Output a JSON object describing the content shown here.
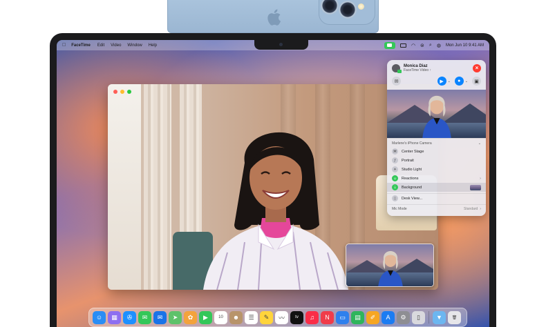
{
  "menubar": {
    "app_name": "FaceTime",
    "menus": [
      "Edit",
      "Video",
      "Window",
      "Help"
    ],
    "clock": "Mon Jun 10  9:41 AM"
  },
  "panel": {
    "caller_name": "Monica Diaz",
    "caller_status": "FaceTime Video ↑",
    "camera_section": "Marlene's iPhone Camera",
    "items": [
      {
        "label": "Center Stage",
        "icon": "center-stage-icon"
      },
      {
        "label": "Portrait",
        "icon": "portrait-icon"
      },
      {
        "label": "Studio Light",
        "icon": "studio-light-icon"
      },
      {
        "label": "Reactions",
        "icon": "reactions-icon"
      },
      {
        "label": "Background",
        "icon": "background-icon"
      }
    ],
    "desk_view": "Desk View...",
    "mic_mode_label": "Mic Mode",
    "mic_mode_value": "Standard"
  },
  "colors": {
    "facetime_green": "#34c759",
    "accent_blue": "#0a84ff",
    "end_red": "#ff3b30"
  },
  "dock_apps": [
    {
      "name": "finder",
      "color": "#2a8df4",
      "glyph": "☺"
    },
    {
      "name": "launchpad",
      "color": "#8e6ff0",
      "glyph": "▦"
    },
    {
      "name": "safari",
      "color": "#1e90ff",
      "glyph": "✇"
    },
    {
      "name": "messages",
      "color": "#34c759",
      "glyph": "✉"
    },
    {
      "name": "mail",
      "color": "#1a73e8",
      "glyph": "✉"
    },
    {
      "name": "maps",
      "color": "#5ec26a",
      "glyph": "➤"
    },
    {
      "name": "photos",
      "color": "#f3a33c",
      "glyph": "✿"
    },
    {
      "name": "facetime",
      "color": "#34c759",
      "glyph": "▶"
    },
    {
      "name": "calendar",
      "color": "#ffffff",
      "glyph": "10"
    },
    {
      "name": "contacts",
      "color": "#b8946a",
      "glyph": "☻"
    },
    {
      "name": "reminders",
      "color": "#ffffff",
      "glyph": "☰"
    },
    {
      "name": "notes",
      "color": "#ffd43b",
      "glyph": "✎"
    },
    {
      "name": "freeform",
      "color": "#ffffff",
      "glyph": "〰"
    },
    {
      "name": "tv",
      "color": "#111111",
      "glyph": "tv"
    },
    {
      "name": "music",
      "color": "#fa2d48",
      "glyph": "♫"
    },
    {
      "name": "news",
      "color": "#f03c4a",
      "glyph": "N"
    },
    {
      "name": "keynote",
      "color": "#2f80ed",
      "glyph": "▭"
    },
    {
      "name": "numbers",
      "color": "#2fb55c",
      "glyph": "▤"
    },
    {
      "name": "pages",
      "color": "#f6a623",
      "glyph": "✐"
    },
    {
      "name": "app-store",
      "color": "#1c7cf2",
      "glyph": "A"
    },
    {
      "name": "system-settings",
      "color": "#8e8e93",
      "glyph": "⚙"
    },
    {
      "name": "iphone-mirroring",
      "color": "#d9d9de",
      "glyph": "▯"
    },
    {
      "name": "downloads",
      "color": "#6cb6f0",
      "glyph": "▼"
    },
    {
      "name": "trash",
      "color": "#e6e6ea",
      "glyph": "🗑"
    }
  ]
}
